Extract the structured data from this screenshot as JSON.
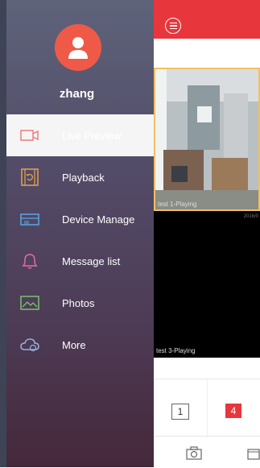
{
  "user": {
    "name": "zhang"
  },
  "menu": [
    {
      "label": "Live Preview",
      "icon": "live-preview-icon",
      "active": true
    },
    {
      "label": "Playback",
      "icon": "playback-icon"
    },
    {
      "label": "Device Manage",
      "icon": "device-manage-icon"
    },
    {
      "label": "Message list",
      "icon": "message-bell-icon"
    },
    {
      "label": "Photos",
      "icon": "photos-icon"
    },
    {
      "label": "More",
      "icon": "cloud-more-icon"
    }
  ],
  "preview": {
    "tiles": [
      {
        "label": "test 1-Playing"
      },
      {
        "label": "test 3-Playing",
        "timestamp": "2016/0"
      }
    ],
    "layout_buttons": [
      "1",
      "4"
    ]
  },
  "colors": {
    "accent": "#e8363d",
    "avatar": "#ef5a48"
  }
}
